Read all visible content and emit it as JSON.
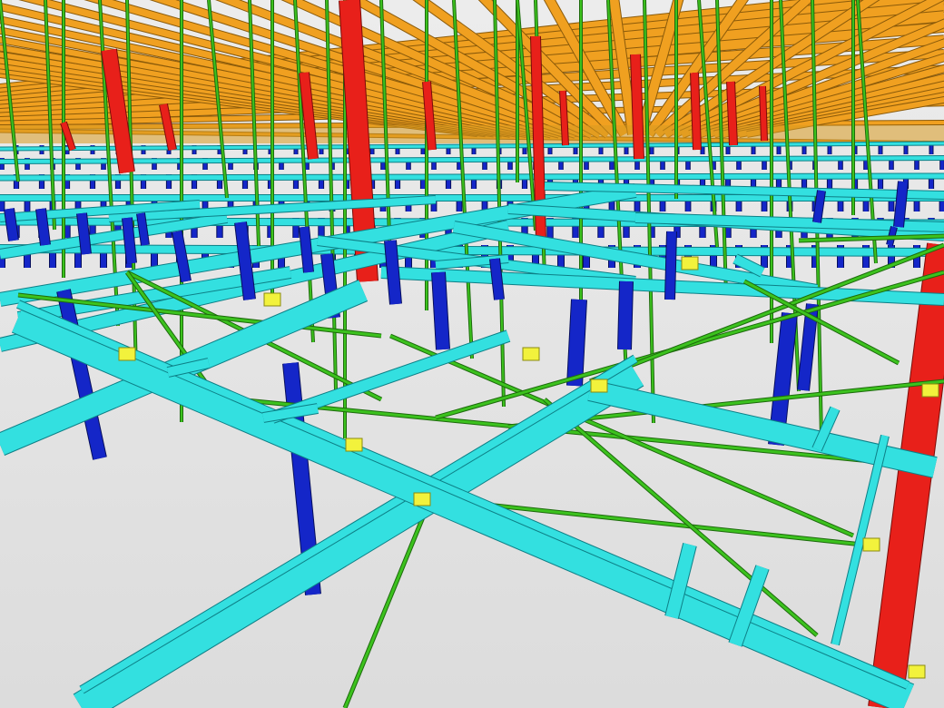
{
  "model": {
    "background_color": "#e4e4e4",
    "floor_color": "#dcdcdc",
    "member_types": [
      {
        "name": "roof-beam",
        "color": "#f0a020",
        "edge": "#8a5a0a"
      },
      {
        "name": "column",
        "color": "#e8201a",
        "edge": "#7a0c08"
      },
      {
        "name": "platform-beam",
        "color": "#33e0e0",
        "edge": "#0d7f86"
      },
      {
        "name": "support-post",
        "color": "#1426c8",
        "edge": "#070f5c"
      },
      {
        "name": "bracing-rod",
        "color": "#3cc21e",
        "edge": "#1d6a0c"
      },
      {
        "name": "connection-plate",
        "color": "#f2f23c",
        "edge": "#8a8a10"
      }
    ]
  }
}
